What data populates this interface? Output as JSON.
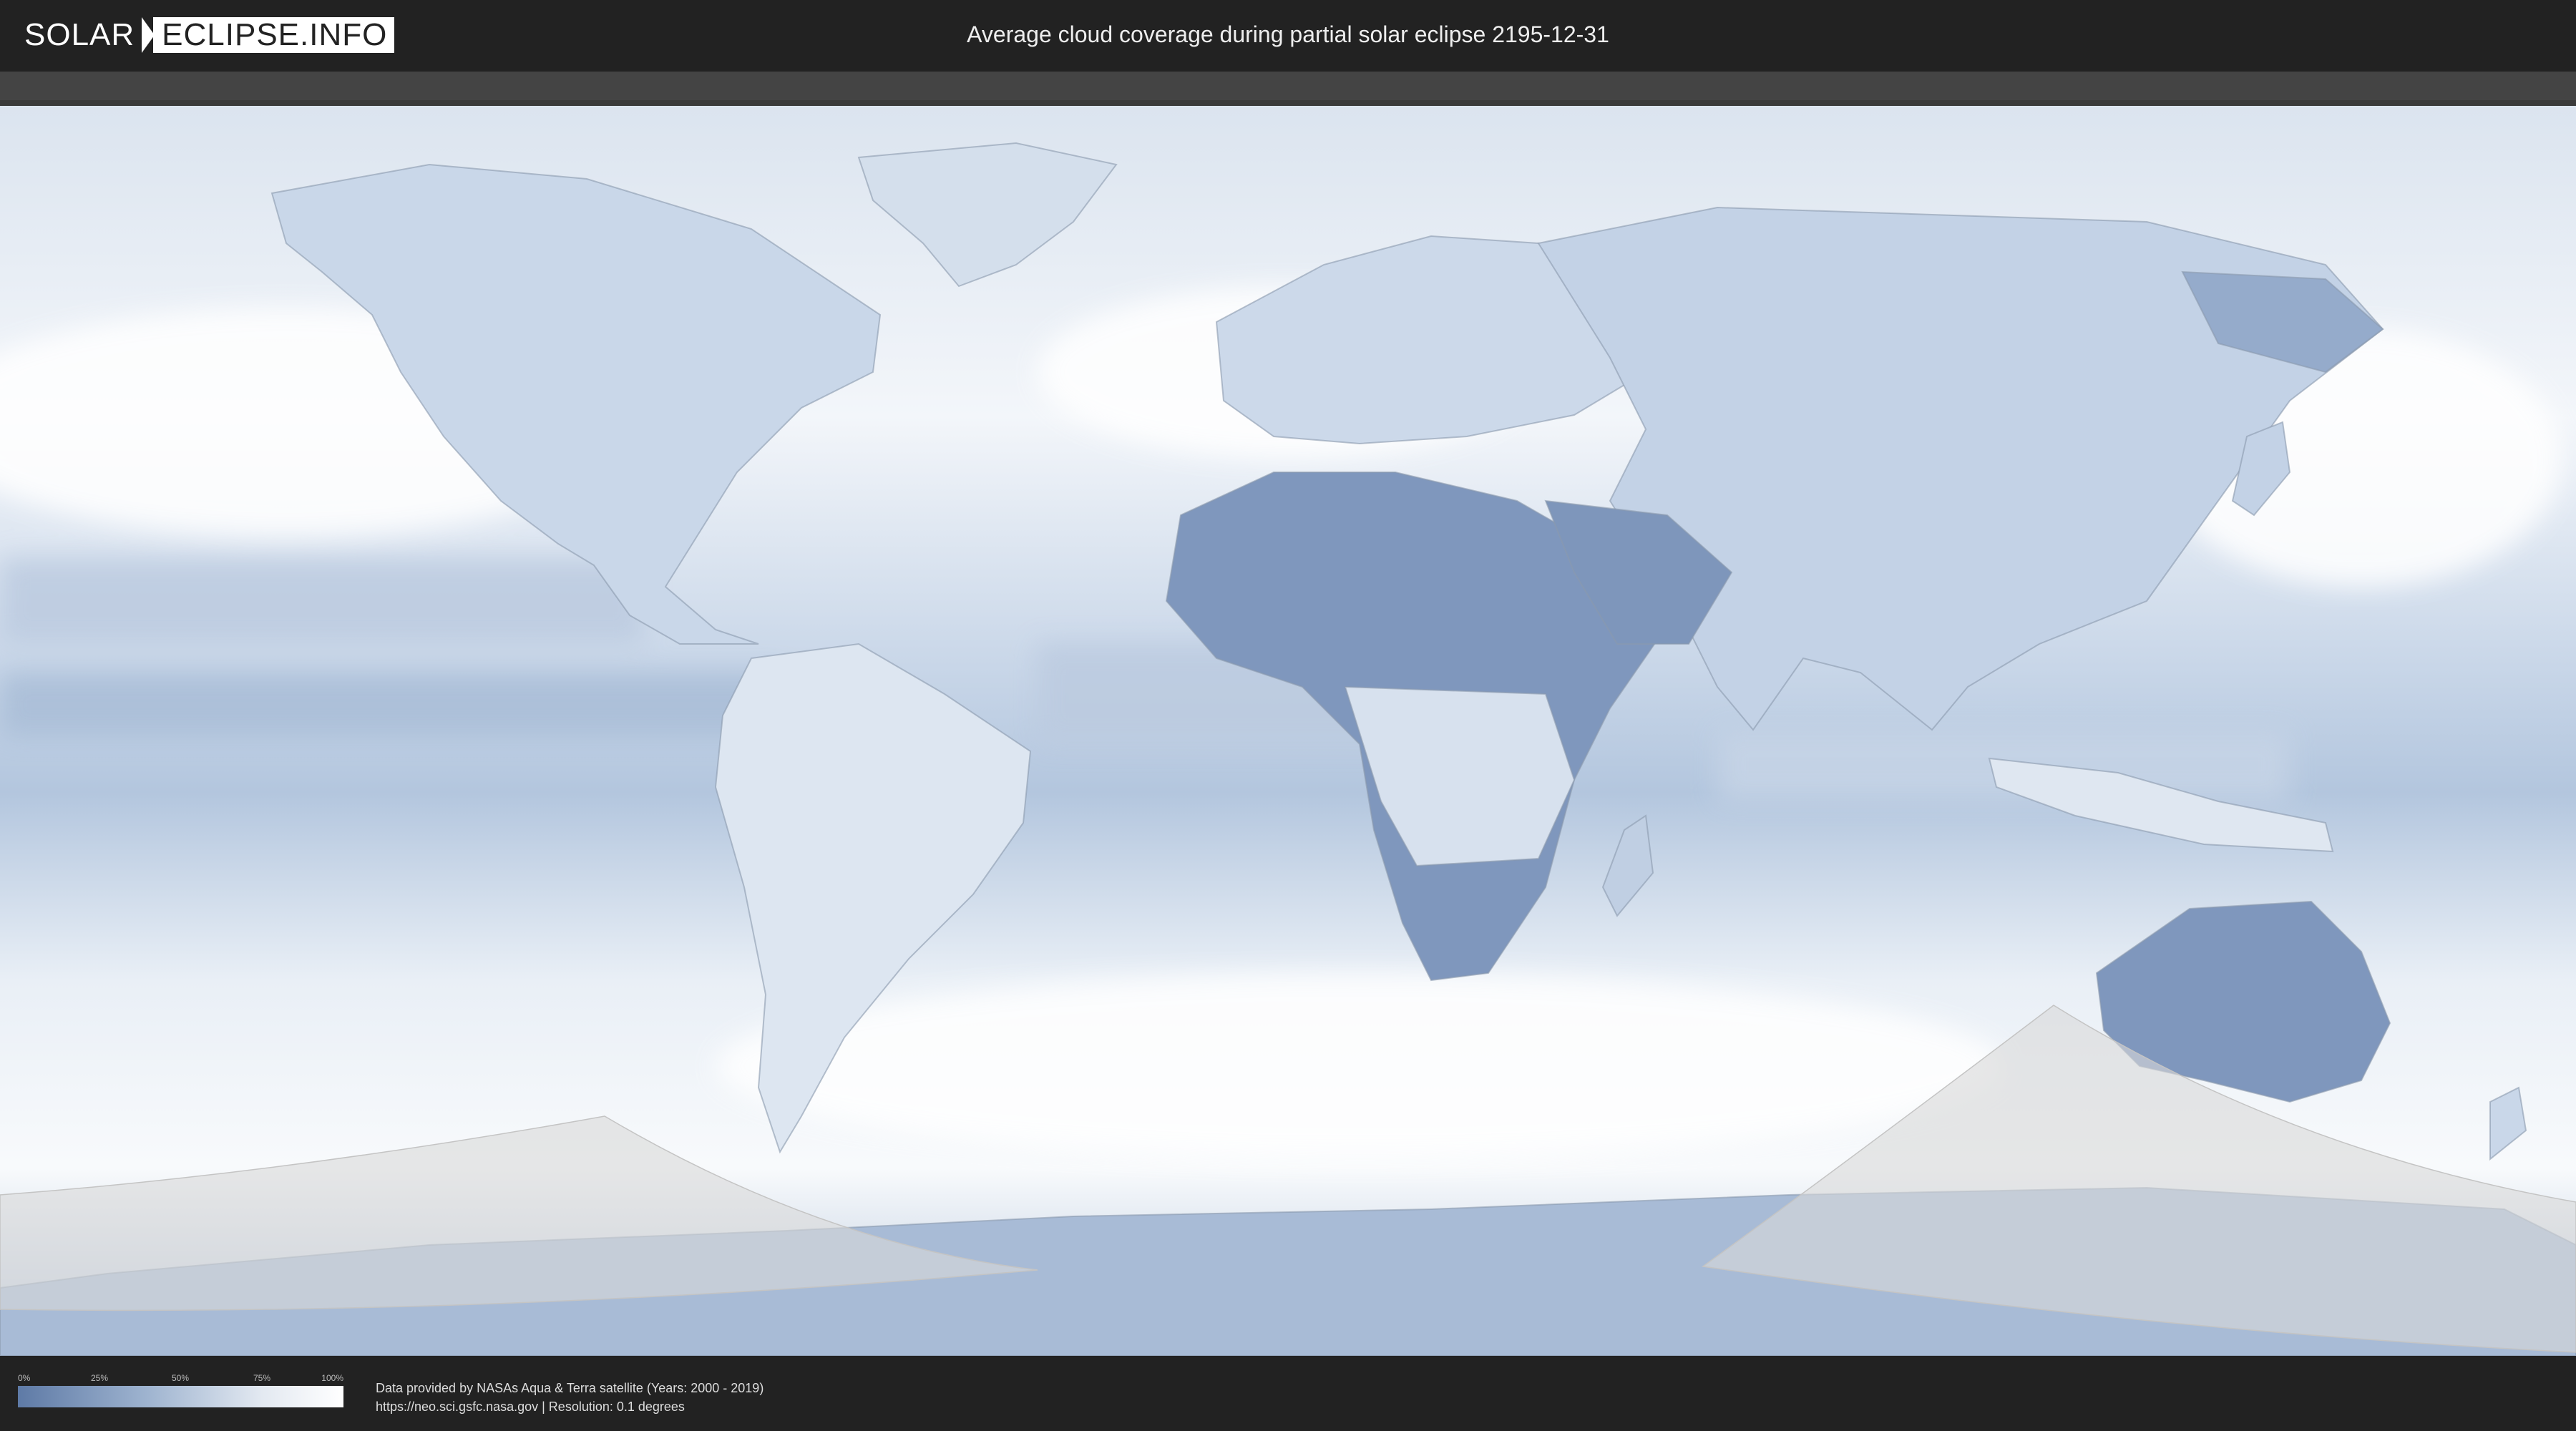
{
  "header": {
    "logo_part1": "SOLAR",
    "logo_part2": "ECLIPSE.INFO",
    "title": "Average cloud coverage during partial solar eclipse 2195-12-31"
  },
  "legend": {
    "ticks": [
      "0%",
      "25%",
      "50%",
      "75%",
      "100%"
    ],
    "min_color": "#5e7aa6",
    "max_color": "#ffffff"
  },
  "credits": {
    "line1": "Data provided by NASAs Aqua & Terra satellite (Years: 2000 - 2019)",
    "line2": "https://neo.sci.gsfc.nasa.gov | Resolution: 0.1 degrees"
  },
  "map": {
    "cloud_color_low": "#5e7aa6",
    "cloud_color_high": "#ffffff",
    "eclipse_zone_color": "#d8d8d8"
  }
}
